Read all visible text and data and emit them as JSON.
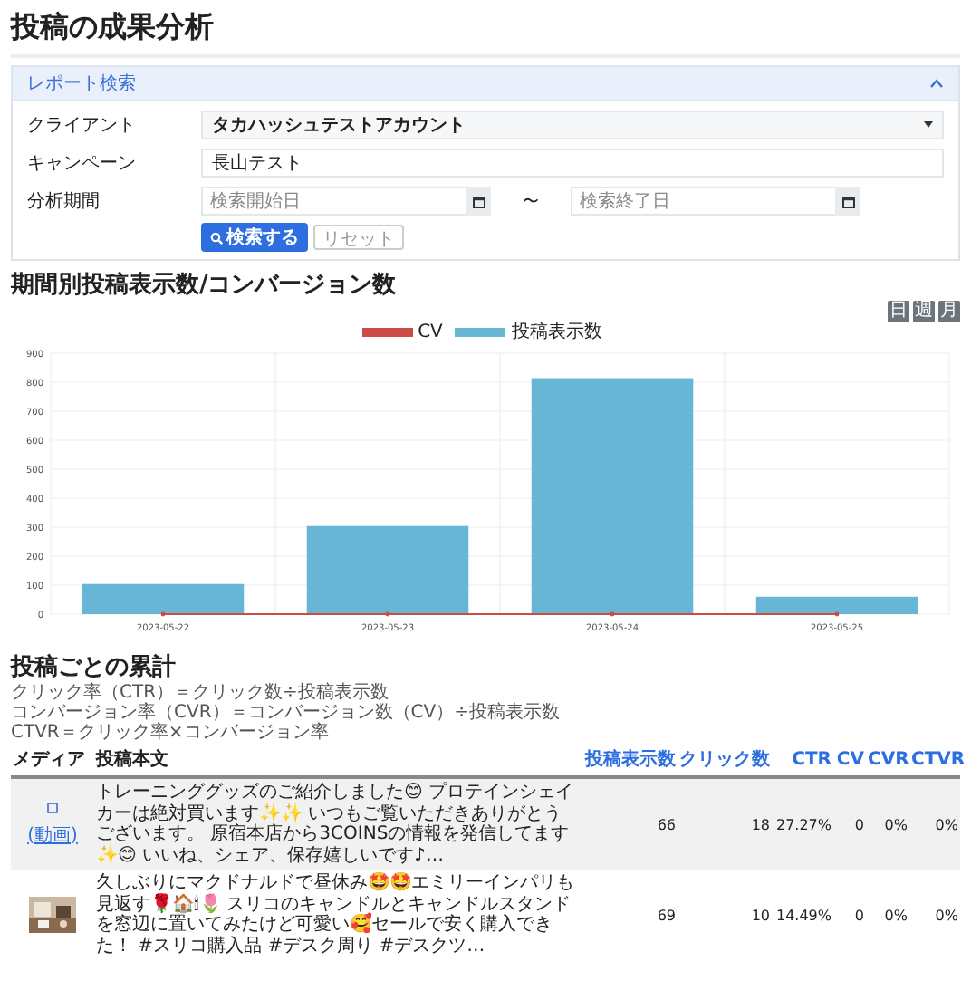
{
  "page_title": "投稿の成果分析",
  "search_panel": {
    "title": "レポート検索",
    "expanded": true,
    "fields": [
      {
        "kind": "select",
        "label": "クライアント",
        "value": "タカハッシュテストアカウント"
      },
      {
        "kind": "text",
        "label": "キャンペーン",
        "value": "長山テスト"
      },
      {
        "kind": "daterange",
        "label": "分析期間",
        "start_placeholder": "検索開始日",
        "separator": "〜",
        "end_placeholder": "検索終了日"
      }
    ],
    "search_button": "検索する",
    "reset_button": "リセット"
  },
  "chart_section": {
    "title": "期間別投稿表示数/コンバージョン数",
    "period_buttons": [
      "日",
      "週",
      "月"
    ],
    "chart_data": {
      "type": "bar",
      "grid": true,
      "categories": [
        "2023-05-22",
        "2023-05-23",
        "2023-05-24",
        "2023-05-25"
      ],
      "ylim": [
        0,
        900
      ],
      "yticks": [
        0,
        100,
        200,
        300,
        400,
        500,
        600,
        700,
        800,
        900
      ],
      "series": [
        {
          "name": "CV",
          "color": "#cc4b45",
          "values": [
            0,
            0,
            0,
            0
          ]
        },
        {
          "name": "投稿表示数",
          "color": "#68b6d6",
          "values": [
            104,
            304,
            814,
            60
          ]
        }
      ]
    }
  },
  "posts_section": {
    "title": "投稿ごとの累計",
    "notes": [
      "クリック率（CTR）＝クリック数÷投稿表示数",
      "コンバージョン率（CVR）＝コンバージョン数（CV）÷投稿表示数",
      "CTVR＝クリック率×コンバージョン率"
    ],
    "columns": [
      "メディア",
      "投稿本文",
      "投稿表示数",
      "クリック数",
      "CTR",
      "CV",
      "CVR",
      "CTVR"
    ],
    "rows": [
      {
        "media": {
          "kind": "video",
          "label": "(動画)"
        },
        "text": "トレーニンググッズのご紹介しました😊 プロテインシェイカーは絶対買います✨✨ いつもご覧いただきありがとうございます。 原宿本店から3COINSの情報を発信してます✨😊 いいね、シェア、保存嬉しいです♪…",
        "impressions": "66",
        "clicks": "18",
        "ctr": "27.27%",
        "cv": "0",
        "cvr": "0%",
        "ctvr": "0%"
      },
      {
        "text": "久しぶりにマクドナルドで昼休み🤩🤩エミリーインパリも見返す🌹🏠🕯🌷 スリコのキャンドルとキャンドルスタンドを窓辺に置いてみたけど可愛い🥰セールで安く購入できた！ #スリコ購入品 #デスク周り #デスクツ…",
        "impressions": "69",
        "clicks": "10",
        "ctr": "14.49%",
        "cv": "0",
        "cvr": "0%",
        "ctvr": "0%"
      }
    ]
  }
}
